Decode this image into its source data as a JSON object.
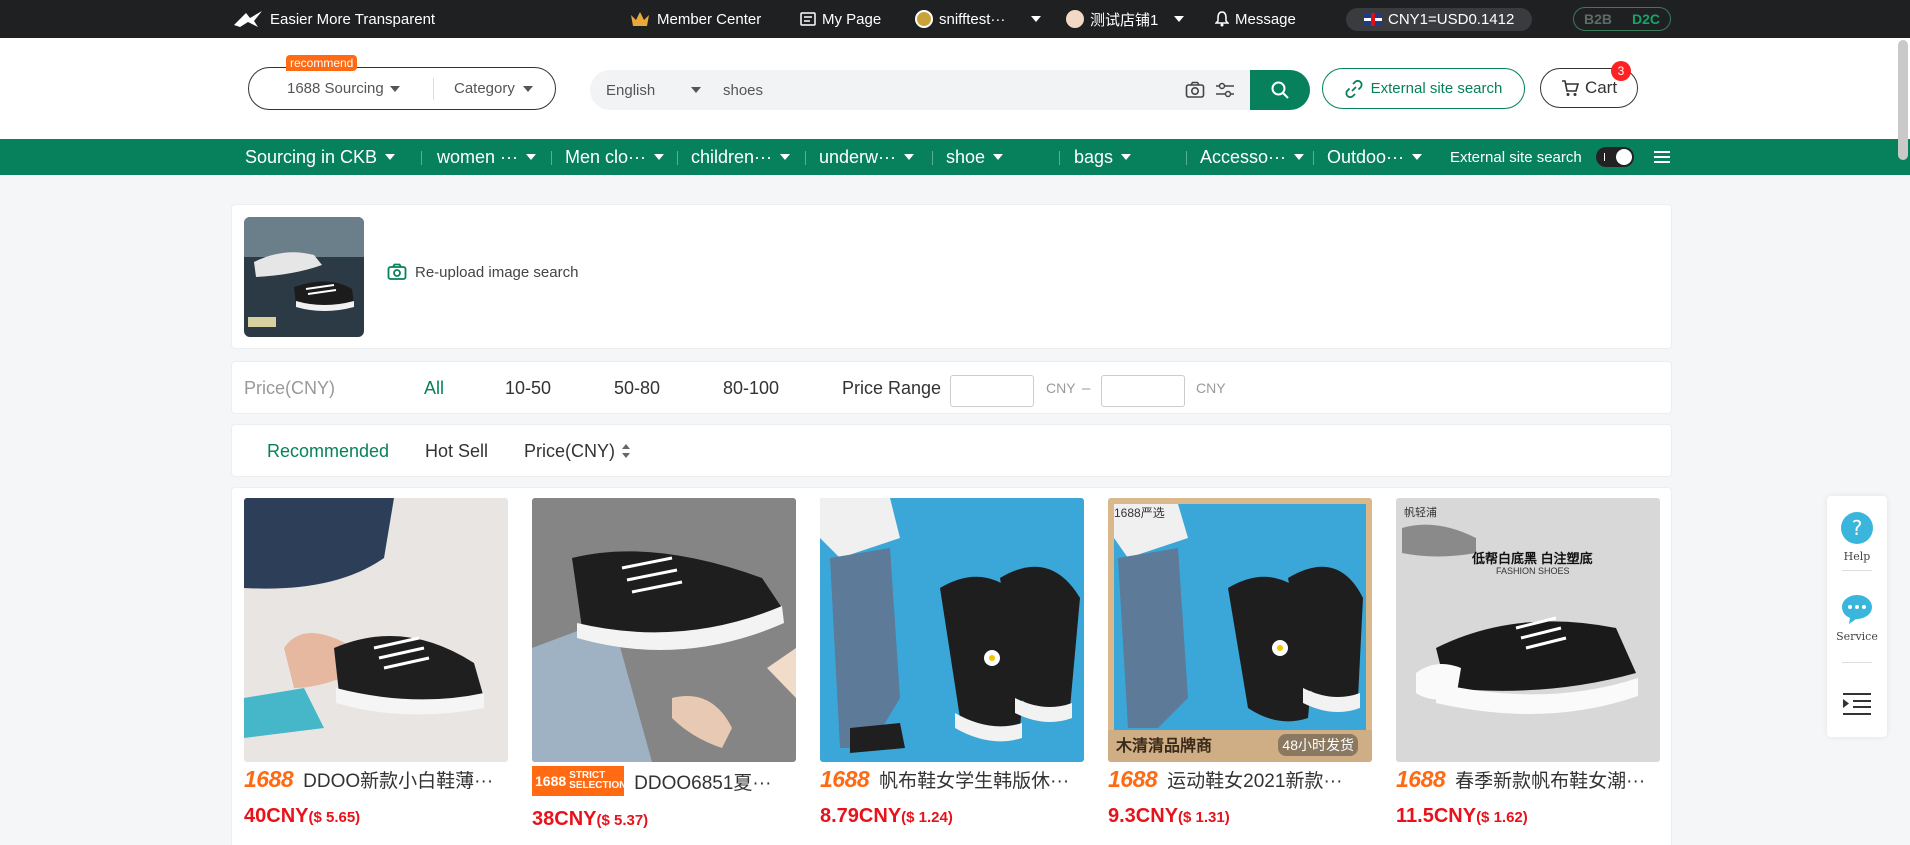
{
  "topbar": {
    "slogan": "Easier More Transparent",
    "member_center": "Member Center",
    "my_page": "My Page",
    "user": "snifftest···",
    "shop": "测试店铺1",
    "message": "Message",
    "rate": "CNY1=USD0.1412",
    "mode_b2b": "B2B",
    "mode_d2c": "D2C"
  },
  "header": {
    "recommend_badge": "recommend",
    "source": "1688 Sourcing",
    "category": "Category",
    "language": "English",
    "query": "shoes",
    "external_search": "External site search",
    "cart_label": "Cart",
    "cart_count": "3"
  },
  "catbar": {
    "items": [
      "Sourcing in CKB",
      "women ···",
      "Men clo···",
      "children···",
      "underw···",
      "shoe",
      "bags",
      "Accesso···",
      "Outdoo···"
    ],
    "external_label": "External site search"
  },
  "image_search": {
    "reupload": "Re-upload image search"
  },
  "price_filter": {
    "label": "Price(CNY)",
    "options": [
      "All",
      "10-50",
      "50-80",
      "80-100"
    ],
    "range_label": "Price Range",
    "unit1": "CNY",
    "dash": "–",
    "unit2": "CNY"
  },
  "sort": {
    "recommended": "Recommended",
    "hot_sell": "Hot Sell",
    "price": "Price(CNY)"
  },
  "products": [
    {
      "brand": "1688",
      "title": "DDOO新款小白鞋薄···",
      "price": "40CNY",
      "usd": "($ 5.65)"
    },
    {
      "brand": "1688",
      "strict": "STRICT SELECTION",
      "title": "DDOO6851夏···",
      "price": "38CNY",
      "usd": "($ 5.37)"
    },
    {
      "brand": "1688",
      "title": "帆布鞋女学生韩版休···",
      "price": "8.79CNY",
      "usd": "($ 1.24)"
    },
    {
      "brand": "1688",
      "title": "运动鞋女2021新款···",
      "price": "9.3CNY",
      "usd": "($ 1.31)",
      "img_tag_top": "1688严选",
      "img_tag_left": "木清清品牌商",
      "img_tag_right": "48小时发货"
    },
    {
      "brand": "1688",
      "title": "春季新款帆布鞋女潮···",
      "price": "11.5CNY",
      "usd": "($ 1.62)",
      "img_brand": "帆轻浦",
      "img_caption": "低帮白底黑 白注塑底",
      "img_sub": "FASHION SHOES"
    }
  ],
  "side": {
    "help": "Help",
    "service": "Service"
  },
  "colors": {
    "brand_green": "#06815b",
    "price_red": "#e8121b",
    "accent_orange": "#ff6a13"
  }
}
